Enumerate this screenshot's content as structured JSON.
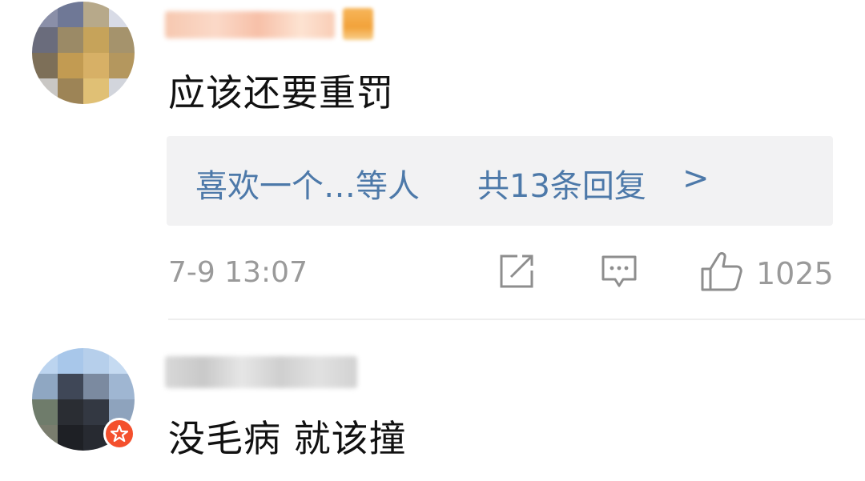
{
  "comments": [
    {
      "text": "应该还要重罚",
      "reply_summary": {
        "users": "喜欢一个…等人",
        "count": "共13条回复",
        "arrow": ">"
      },
      "timestamp": "7-9 13:07",
      "like_count": "1025",
      "icons": {
        "share": "share-icon",
        "reply": "comment-icon",
        "like": "thumbs-up-icon"
      }
    },
    {
      "text": "没毛病  就该撞",
      "badge": "vip-badge-icon"
    }
  ],
  "colors": {
    "link_blue": "#4d79a9",
    "meta_gray": "#9a9a9a",
    "reply_bg": "#f2f2f3",
    "badge_red": "#f4502d"
  }
}
